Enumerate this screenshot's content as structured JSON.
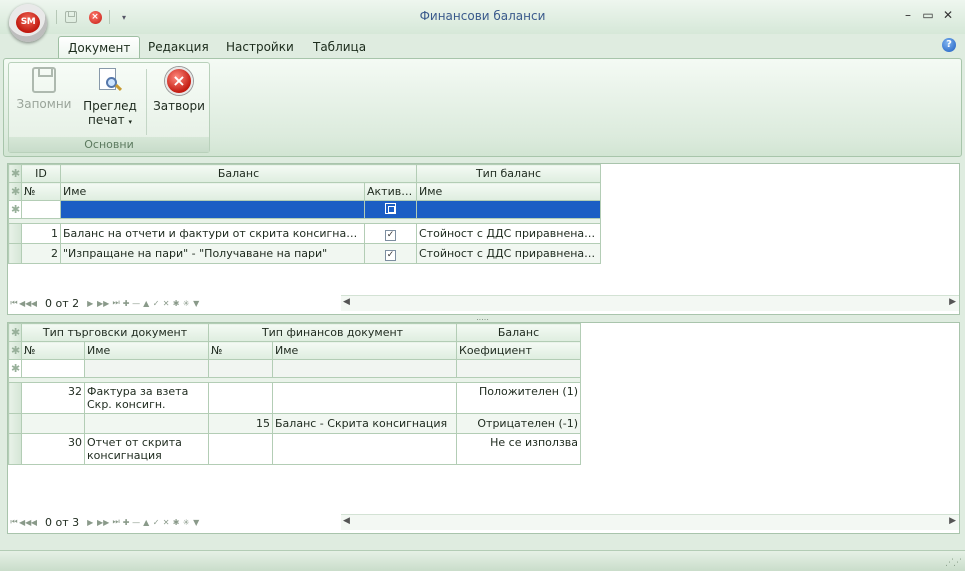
{
  "window": {
    "title": "Финансови баланси",
    "app_badge": "SM",
    "controls": {
      "minimize": "–",
      "maximize": "▭",
      "close": "✕"
    }
  },
  "quick_access": {
    "save": "save-icon",
    "close": "close-icon",
    "dropdown": "▾"
  },
  "ribbon": {
    "tabs": [
      {
        "label": "Документ",
        "active": true
      },
      {
        "label": "Редакция",
        "active": false
      },
      {
        "label": "Настройки",
        "active": false
      },
      {
        "label": "Таблица",
        "active": false
      }
    ],
    "help": "?",
    "group": {
      "label": "Основни",
      "buttons": [
        {
          "label": "Запомни",
          "enabled": false,
          "icon": "save-icon"
        },
        {
          "label_line1": "Преглед",
          "label_line2": "печат",
          "enabled": true,
          "icon": "print-preview-icon"
        },
        {
          "label": "Затвори",
          "enabled": true,
          "icon": "close-icon"
        }
      ]
    }
  },
  "balances_grid": {
    "bands": {
      "id": "ID",
      "balance": "Баланс",
      "type": "Тип баланс"
    },
    "columns": {
      "no": "№",
      "name": "Име",
      "active": "Активен",
      "type_name": "Име"
    },
    "rows": [
      {
        "no": "1",
        "name": "Баланс на отчети и фактури от скрита консигнация",
        "active": true,
        "type_name": "Стойност с ДДС приравнена към..."
      },
      {
        "no": "2",
        "name": "\"Изпращане на пари\" - \"Получаване на пари\"",
        "active": true,
        "type_name": "Стойност с ДДС приравнена към..."
      }
    ],
    "navigator": {
      "text": "0 от 2"
    }
  },
  "documents_grid": {
    "bands": {
      "trade_doc": "Тип търговски документ",
      "fin_doc": "Тип финансов документ",
      "balance": "Баланс"
    },
    "columns": {
      "trade_no": "№",
      "trade_name": "Име",
      "fin_no": "№",
      "fin_name": "Име",
      "coef": "Коефициент"
    },
    "rows": [
      {
        "trade_no": "32",
        "trade_name": "Фактура за взета Скр. консигн.",
        "fin_no": "",
        "fin_name": "",
        "coef": "Положителен (1)"
      },
      {
        "trade_no": "",
        "trade_name": "",
        "fin_no": "15",
        "fin_name": "Баланс - Скрита консигнация",
        "coef": "Отрицателен (-1)"
      },
      {
        "trade_no": "30",
        "trade_name": "Отчет от скрита консигнация",
        "fin_no": "",
        "fin_name": "",
        "coef": "Не се използва"
      }
    ],
    "navigator": {
      "text": "0 от 3"
    }
  },
  "indicator": "✱"
}
